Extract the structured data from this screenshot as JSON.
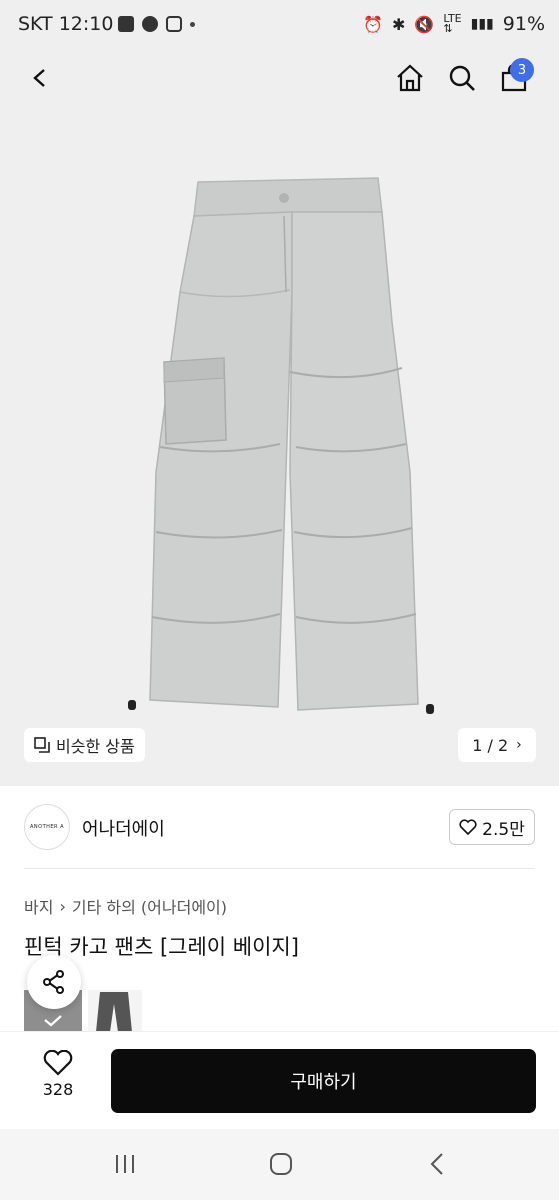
{
  "status_bar": {
    "carrier_time": "SKT 12:10",
    "left_icons": [
      "gallery-icon",
      "talk-icon",
      "instagram-icon",
      "dot-icon"
    ],
    "right_icons": [
      "alarm-icon",
      "bluetooth-icon",
      "mute-icon",
      "lte-icon",
      "signal-icon"
    ],
    "battery": "91%"
  },
  "header": {
    "back_icon": "chevron-left-icon",
    "home_icon": "home-icon",
    "search_icon": "search-icon",
    "cart_icon": "bag-icon",
    "cart_count": "3"
  },
  "gallery": {
    "similar_label": "비슷한 상품",
    "pager": "1 / 2"
  },
  "brand": {
    "logo_text": "ANOTHER A",
    "name": "어나더에이",
    "likes": "2.5만"
  },
  "breadcrumb": {
    "items": [
      "바지",
      "기타 하의 (어나더에이)"
    ]
  },
  "product": {
    "title": "핀턱 카고 팬츠 [그레이 베이지]"
  },
  "bottom": {
    "wish_count": "328",
    "buy_label": "구매하기"
  },
  "colors": {
    "accent_badge": "#3f6fe8",
    "buy_button": "#0b0b0b",
    "hero_bg": "#efefef"
  }
}
